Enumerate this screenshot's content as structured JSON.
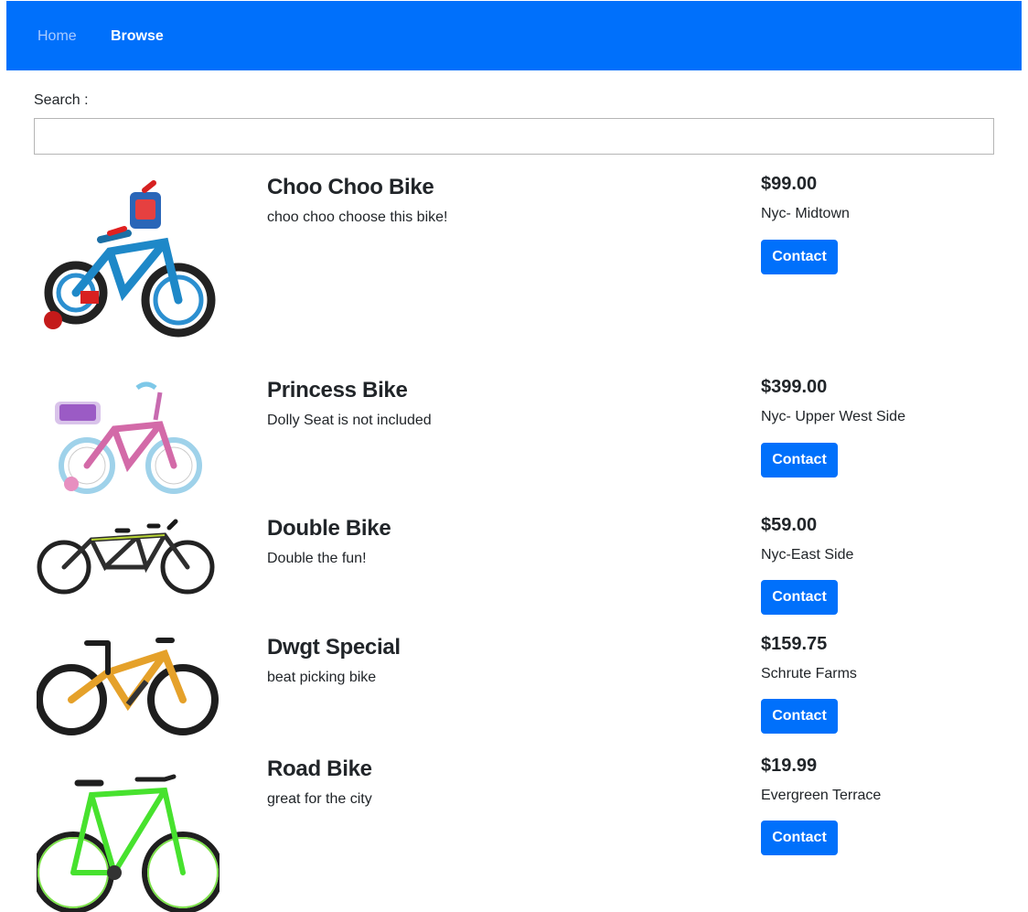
{
  "nav": {
    "home": "Home",
    "browse": "Browse"
  },
  "search": {
    "label": "Search :",
    "value": "",
    "placeholder": ""
  },
  "listings": [
    {
      "title": "Choo Choo Bike",
      "description": "choo choo choose this bike!",
      "price": "$99.00",
      "location": "Nyc- Midtown",
      "button": "Contact"
    },
    {
      "title": "Princess Bike",
      "description": "Dolly Seat is not included",
      "price": "$399.00",
      "location": "Nyc- Upper West Side",
      "button": "Contact"
    },
    {
      "title": "Double Bike",
      "description": "Double the fun!",
      "price": "$59.00",
      "location": "Nyc-East Side",
      "button": "Contact"
    },
    {
      "title": "Dwgt Special",
      "description": "beat picking bike",
      "price": "$159.75",
      "location": "Schrute Farms",
      "button": "Contact"
    },
    {
      "title": "Road Bike",
      "description": "great for the city",
      "price": "$19.99",
      "location": "Evergreen Terrace",
      "button": "Contact"
    }
  ],
  "colors": {
    "primary": "#0070fb",
    "text": "#212529"
  }
}
